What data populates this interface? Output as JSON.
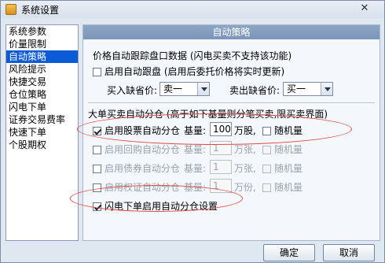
{
  "window": {
    "title": "系统设置",
    "close_glyph": "✕"
  },
  "sidebar": {
    "items": [
      {
        "label": "系统参数"
      },
      {
        "label": "价量限制"
      },
      {
        "label": "自动策略",
        "selected": true
      },
      {
        "label": "风险提示"
      },
      {
        "label": "快捷交易"
      },
      {
        "label": "仓位策略"
      },
      {
        "label": "闪电下单"
      },
      {
        "label": "证券交易费率"
      },
      {
        "label": "快速下单"
      },
      {
        "label": "个股期权"
      }
    ]
  },
  "panel": {
    "header": "自动策略",
    "tracking": {
      "section_title": "价格自动跟踪盘口数据 (闪电买卖不支持该功能)",
      "enable_label": "启用自动跟盘 (启用后委托价格将实时更新)",
      "enable_checked": false,
      "buy_label": "买入缺省价:",
      "buy_value": "卖一",
      "sell_label": "卖出缺省价:",
      "sell_value": "买一"
    },
    "split": {
      "section_title": "大单买卖自动分仓 (高于如下基量则分笔买卖,限买卖界面)",
      "base_label": "基量:",
      "random_label": "随机量",
      "rows": [
        {
          "label": "启用股票自动分仓",
          "checked": true,
          "enabled": true,
          "value": "100",
          "unit": "万股,",
          "random_checked": false
        },
        {
          "label": "启用回购自动分仓",
          "checked": false,
          "enabled": false,
          "value": "1",
          "unit": "万张,",
          "random_checked": false
        },
        {
          "label": "启用债券自动分仓",
          "checked": false,
          "enabled": false,
          "value": "1",
          "unit": "万张,",
          "random_checked": false
        },
        {
          "label": "启用权证自动分仓",
          "checked": false,
          "enabled": false,
          "value": "1",
          "unit": "万份,",
          "random_checked": false
        }
      ],
      "flash_label": "闪电下单启用自动分仓设置",
      "flash_checked": true
    }
  },
  "buttons": {
    "ok": "确定",
    "cancel": "取消"
  },
  "annotation_color": "#e04a4a",
  "selection_color": "#0b5ad6"
}
